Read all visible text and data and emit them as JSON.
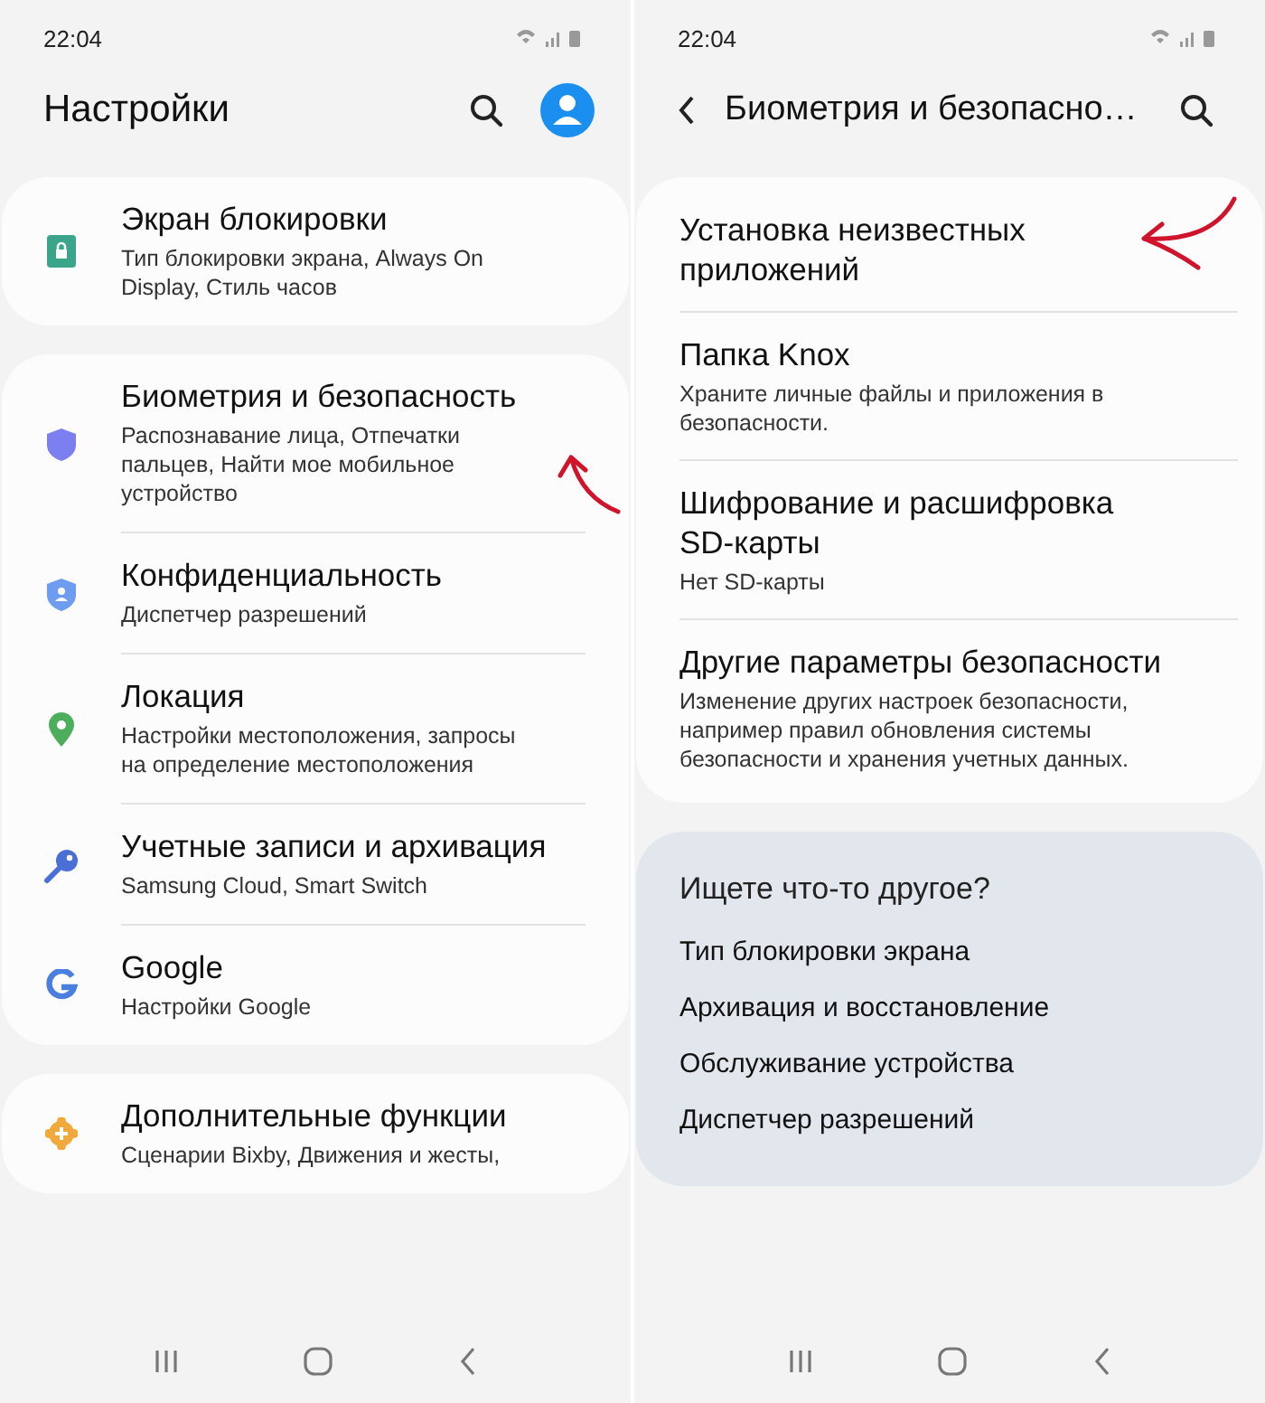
{
  "left": {
    "status_bar": {
      "time": "22:04"
    },
    "title": "Настройки",
    "groups": [
      {
        "items": [
          {
            "kind": "lock",
            "color": "#3aa58a",
            "title": "Экран блокировки",
            "subtitle": "Тип блокировки экрана, Always On Display, Стиль часов",
            "annotated": false
          }
        ]
      },
      {
        "items": [
          {
            "kind": "shield",
            "color": "#7b7ff0",
            "title": "Биометрия и безопасность",
            "subtitle": "Распознавание лица, Отпечатки пальцев, Найти мое мобильное устройство",
            "annotated": true
          },
          {
            "kind": "privacy",
            "color": "#6d9cf0",
            "title": "Конфиденциальность",
            "subtitle": "Диспетчер разрешений",
            "annotated": false
          },
          {
            "kind": "location",
            "color": "#4cae5a",
            "title": "Локация",
            "subtitle": "Настройки местоположения, запросы на определение местоположения",
            "annotated": false
          },
          {
            "kind": "key",
            "color": "#4a6fd6",
            "title": "Учетные записи и архивация",
            "subtitle": "Samsung Cloud, Smart Switch",
            "annotated": false
          },
          {
            "kind": "google",
            "color": "#4a7fe0",
            "title": "Google",
            "subtitle": "Настройки Google",
            "annotated": false
          }
        ]
      },
      {
        "items": [
          {
            "kind": "gear",
            "color": "#f2a93b",
            "title": "Дополнительные функции",
            "subtitle": "Сценарии Bixby, Движения и жесты,",
            "annotated": false
          }
        ]
      }
    ]
  },
  "right": {
    "status_bar": {
      "time": "22:04"
    },
    "title": "Биометрия и безопасно…",
    "items": [
      {
        "title": "Установка неизвестных приложений",
        "annotated": true
      },
      {
        "title": "Папка Knox",
        "subtitle": "Храните личные файлы и приложения в безопасности.",
        "annotated": false
      },
      {
        "title": "Шифрование и расшифровка SD-карты",
        "subtitle": "Нет SD-карты",
        "annotated": false
      },
      {
        "title": "Другие параметры безопасности",
        "subtitle": "Изменение других настроек безопасности, например правил обновления системы безопасности и хранения учетных данных.",
        "annotated": false
      }
    ],
    "suggestions": {
      "heading": "Ищете что-то другое?",
      "links": [
        "Тип блокировки экрана",
        "Архивация и восстановление",
        "Обслуживание устройства",
        "Диспетчер разрешений"
      ]
    }
  }
}
